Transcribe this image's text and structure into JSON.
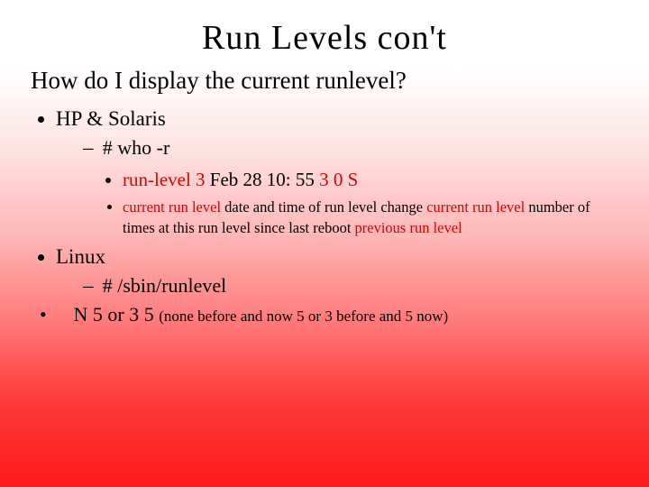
{
  "title": "Run Levels con't",
  "question": "How do I display the current runlevel?",
  "hp_solaris": {
    "label": "HP & Solaris",
    "cmd": "# who -r",
    "output": {
      "p1": "run-level 3",
      "p2": " Feb 28 10: 55 ",
      "p3": "3 0 S"
    },
    "legend": {
      "a": "current run level",
      "b": " date and time of run level change ",
      "c": "current run level",
      "d": " number of times at this run level since last reboot ",
      "e": "previous run level"
    }
  },
  "linux": {
    "label": "Linux",
    "cmd": "# /sbin/runlevel"
  },
  "last": {
    "main": "N 5 or 3 5 ",
    "paren": "(none before and now 5 or 3 before and 5 now)"
  }
}
